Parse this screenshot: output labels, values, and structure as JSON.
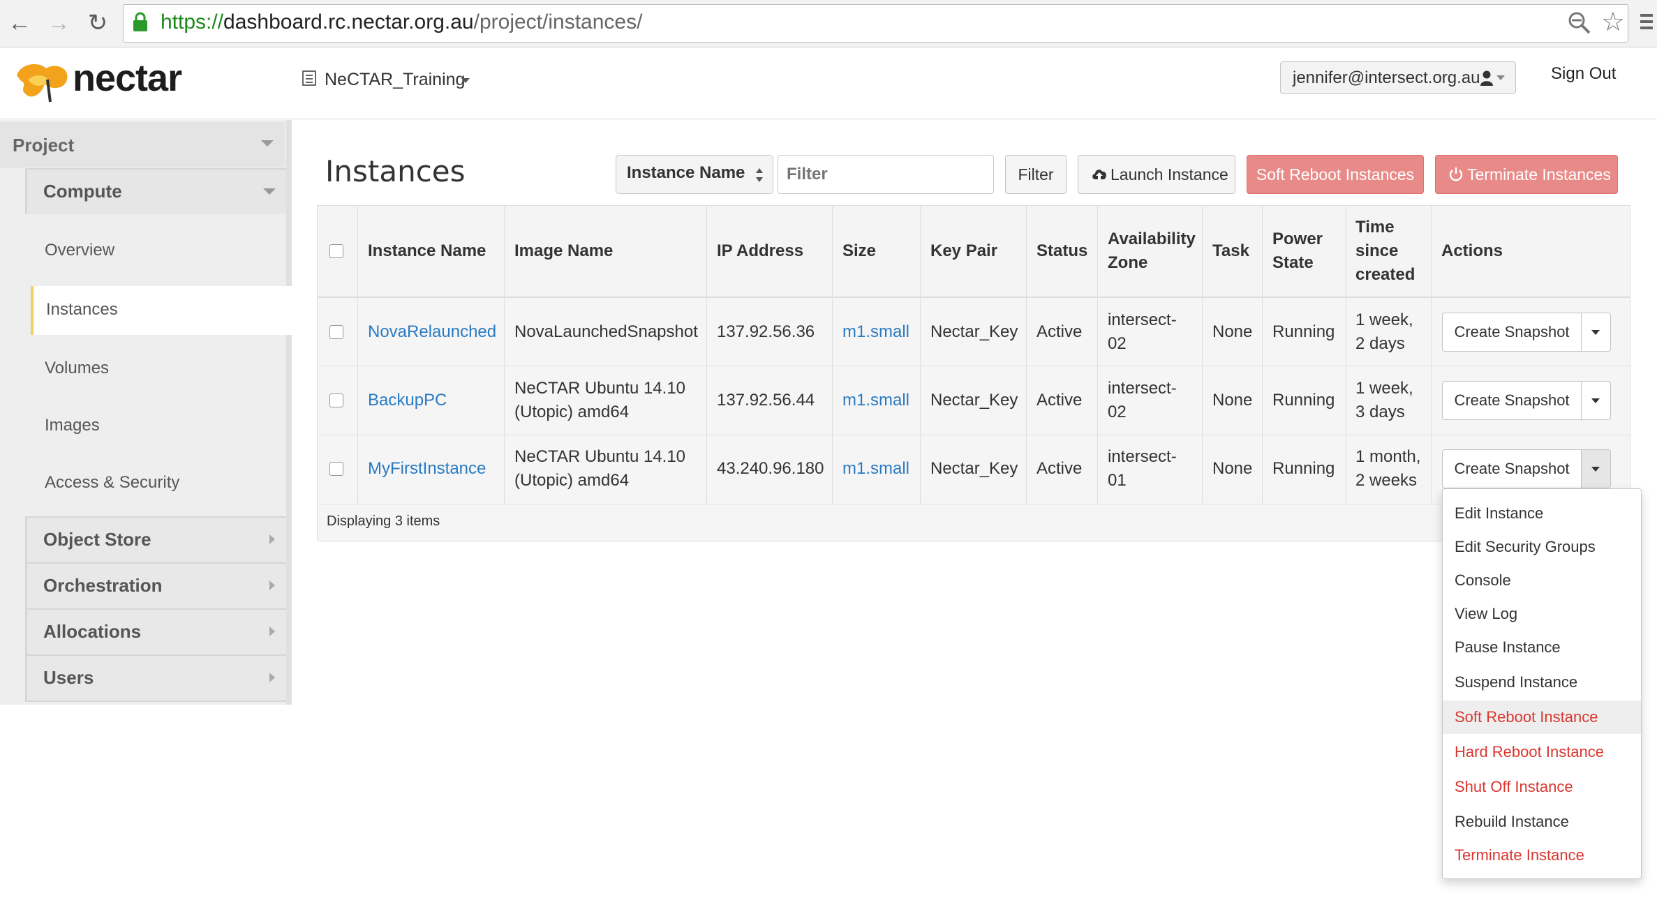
{
  "browser": {
    "url_scheme": "https://",
    "url_host": "dashboard.rc.nectar.org.au",
    "url_path": "/project/instances/"
  },
  "header": {
    "logo_text": "nectar",
    "project_selector": "NeCTAR_Training",
    "user_email": "jennifer@intersect.org.au",
    "sign_out": "Sign Out"
  },
  "sidebar": {
    "section": "Project",
    "group_compute": "Compute",
    "items": [
      {
        "label": "Overview"
      },
      {
        "label": "Instances"
      },
      {
        "label": "Volumes"
      },
      {
        "label": "Images"
      },
      {
        "label": "Access & Security"
      }
    ],
    "groups": [
      {
        "label": "Object Store"
      },
      {
        "label": "Orchestration"
      },
      {
        "label": "Allocations"
      },
      {
        "label": "Users"
      }
    ]
  },
  "main": {
    "title": "Instances",
    "filter_field": "Instance Name",
    "filter_placeholder": "Filter",
    "filter_button": "Filter",
    "launch_button": "Launch Instance",
    "soft_reboot_button": "Soft Reboot Instances",
    "terminate_button": "Terminate Instances"
  },
  "table": {
    "columns": {
      "instance_name": "Instance Name",
      "image_name": "Image Name",
      "ip_address": "IP Address",
      "size": "Size",
      "key_pair": "Key Pair",
      "status": "Status",
      "az_1": "Availability",
      "az_2": "Zone",
      "task": "Task",
      "power_1": "Power",
      "power_2": "State",
      "time_1": "Time",
      "time_2": "since",
      "time_3": "created",
      "actions": "Actions"
    },
    "rows": [
      {
        "name": "NovaRelaunched",
        "image_1": "NovaLaunchedSnapshot",
        "image_2": "",
        "ip": "137.92.56.36",
        "size": "m1.small",
        "key": "Nectar_Key",
        "status": "Active",
        "az_1": "intersect-",
        "az_2": "02",
        "task": "None",
        "power": "Running",
        "time_1": "1 week,",
        "time_2": "2 days",
        "action": "Create Snapshot"
      },
      {
        "name": "BackupPC",
        "image_1": "NeCTAR Ubuntu 14.10",
        "image_2": "(Utopic) amd64",
        "ip": "137.92.56.44",
        "size": "m1.small",
        "key": "Nectar_Key",
        "status": "Active",
        "az_1": "intersect-",
        "az_2": "02",
        "task": "None",
        "power": "Running",
        "time_1": "1 week,",
        "time_2": "3 days",
        "action": "Create Snapshot"
      },
      {
        "name": "MyFirstInstance",
        "image_1": "NeCTAR Ubuntu 14.10",
        "image_2": "(Utopic) amd64",
        "ip": "43.240.96.180",
        "size": "m1.small",
        "key": "Nectar_Key",
        "status": "Active",
        "az_1": "intersect-",
        "az_2": "01",
        "task": "None",
        "power": "Running",
        "time_1": "1 month,",
        "time_2": "2 weeks",
        "action": "Create Snapshot"
      }
    ],
    "footer": "Displaying 3 items"
  },
  "dropdown": {
    "items": [
      {
        "label": "Edit Instance",
        "color": "#333333"
      },
      {
        "label": "Edit Security Groups",
        "color": "#333333"
      },
      {
        "label": "Console",
        "color": "#333333"
      },
      {
        "label": "View Log",
        "color": "#333333"
      },
      {
        "label": "Pause Instance",
        "color": "#333333"
      },
      {
        "label": "Suspend Instance",
        "color": "#333333"
      },
      {
        "label": "Soft Reboot Instance",
        "color": "#d9372f"
      },
      {
        "label": "Hard Reboot Instance",
        "color": "#d9372f"
      },
      {
        "label": "Shut Off Instance",
        "color": "#d9372f"
      },
      {
        "label": "Rebuild Instance",
        "color": "#333333"
      },
      {
        "label": "Terminate Instance",
        "color": "#d9372f"
      }
    ],
    "hovered": "Soft Reboot Instance"
  },
  "colors": {
    "link": "#2a7ac2",
    "danger": "#e88a88",
    "danger_text": "#d9372f",
    "url_secure": "#1a8a1a",
    "active_marker": "#f0d060"
  }
}
